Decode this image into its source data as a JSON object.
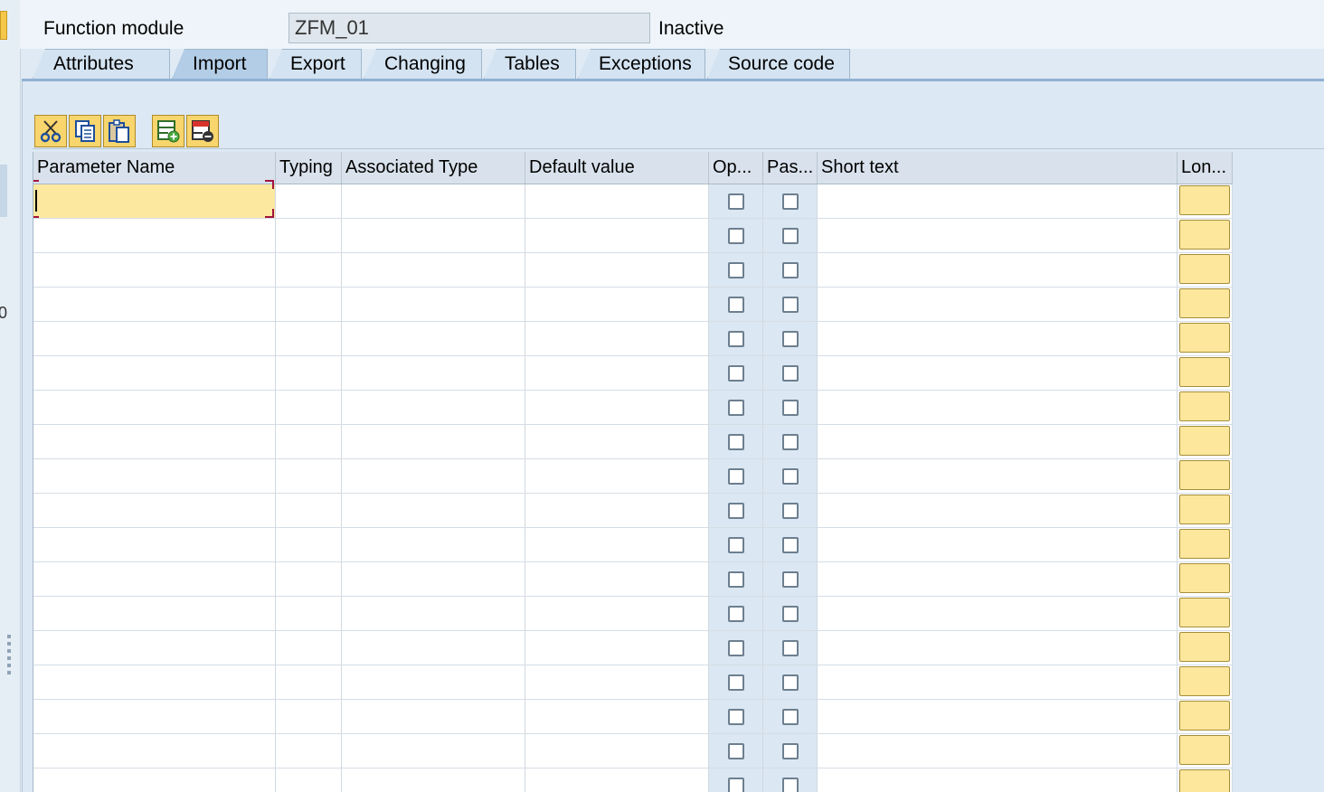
{
  "header": {
    "label": "Function module",
    "value": "ZFM_01",
    "status": "Inactive"
  },
  "tabs": [
    {
      "label": "Attributes",
      "active": false
    },
    {
      "label": "Import",
      "active": true
    },
    {
      "label": "Export",
      "active": false
    },
    {
      "label": "Changing",
      "active": false
    },
    {
      "label": "Tables",
      "active": false
    },
    {
      "label": "Exceptions",
      "active": false
    },
    {
      "label": "Source code",
      "active": false
    }
  ],
  "toolbar": [
    {
      "icon": "scissors-icon",
      "action": "cut"
    },
    {
      "icon": "copy-icon",
      "action": "copy"
    },
    {
      "icon": "paste-icon",
      "action": "paste"
    },
    {
      "icon": "insert-row-icon",
      "action": "insert-row"
    },
    {
      "icon": "delete-row-icon",
      "action": "delete-row"
    }
  ],
  "table": {
    "columns": [
      "Parameter Name",
      "Typing",
      "Associated Type",
      "Default value",
      "Op...",
      "Pas...",
      "Short text",
      "Lon..."
    ],
    "row_count": 18
  },
  "sidebar": {
    "fragment": "0"
  },
  "colors": {
    "accent": "#f8d56d",
    "selected_tab": "#b3cde6",
    "panel": "#dce8f3"
  }
}
